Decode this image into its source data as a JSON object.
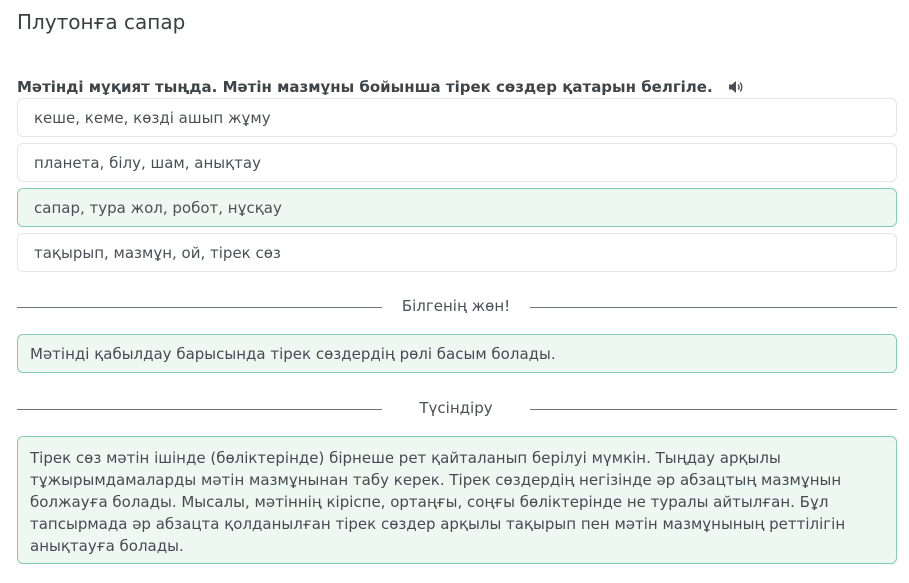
{
  "title": "Плутонға сапар",
  "question": {
    "text": "Мәтінді мұқият тыңда. Мәтін мазмұны бойынша тірек сөздер қатарын белгіле.",
    "audio_icon": "speaker-icon"
  },
  "options": [
    {
      "label": "кеше, кеме, көзді ашып жұму",
      "state": "default"
    },
    {
      "label": "планета, білу, шам, анықтау",
      "state": "default"
    },
    {
      "label": "сапар, тура жол, робот, нұсқау",
      "state": "correct"
    },
    {
      "label": "тақырып, мазмұн, ой, тірек сөз",
      "state": "default"
    }
  ],
  "did_you_know": {
    "heading": "Білгенің жөн!",
    "text": "Мәтінді қабылдау барысында тірек сөздердің рөлі басым болады."
  },
  "explanation": {
    "heading": "Түсіндіру",
    "text": "Тірек сөз мәтін ішінде (бөліктерінде) бірнеше рет қайталанып берілуі мүмкін. Тыңдау арқылы тұжырымдамаларды мәтін мазмұнынан табу керек. Тірек сөздердің негізінде әр абзацтың мазмұнын болжауға болады. Мысалы, мәтіннің кіріспе, ортаңғы, соңғы бөліктерінде не туралы айтылған. Бұл тапсырмада әр абзацта қолданылған тірек сөздер арқылы тақырып пен мәтін мазмұнының реттілігін анықтауға болады."
  },
  "colors": {
    "correct_bg": "#eef8f3",
    "correct_border": "#86cdb0",
    "option_border": "#e3e6e8"
  }
}
